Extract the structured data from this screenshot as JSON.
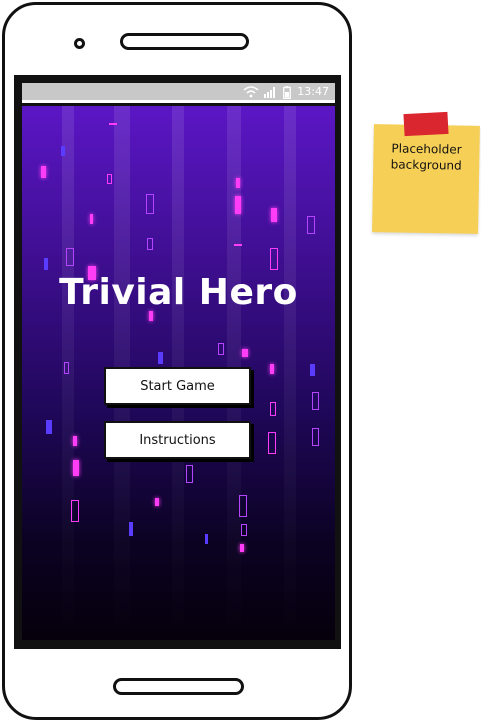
{
  "status_bar": {
    "time": "13:47",
    "wifi_icon": "wifi-icon",
    "signal_icon": "signal-icon",
    "battery_icon": "battery-icon"
  },
  "app": {
    "title": "Trivial Hero",
    "start_button_label": "Start Game",
    "instructions_button_label": "Instructions"
  },
  "sticky_note": {
    "line1": "Placeholder",
    "line2": "background"
  },
  "colors": {
    "gradient_top": "#5b16c5",
    "gradient_bottom": "#05000c",
    "accent_pink": "#ff3cf6",
    "note_yellow": "#f6cf56",
    "tape_red": "#d9262f",
    "statusbar_grey": "#c8c8c8"
  }
}
